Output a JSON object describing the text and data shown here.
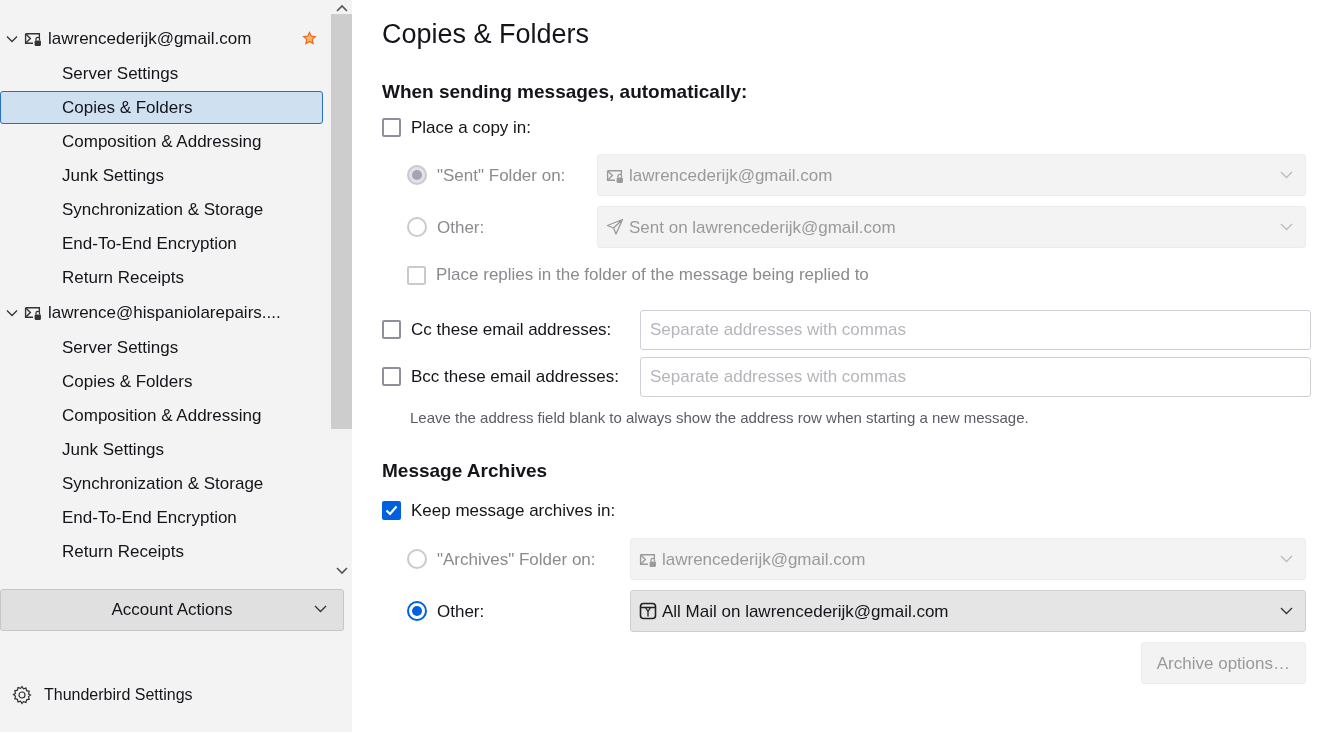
{
  "sidebar": {
    "accounts": [
      {
        "name": "lawrencederijk@gmail.com",
        "expanded": true,
        "default": true,
        "children": [
          {
            "label": "Server Settings",
            "selected": false
          },
          {
            "label": "Copies & Folders",
            "selected": true
          },
          {
            "label": "Composition & Addressing",
            "selected": false
          },
          {
            "label": "Junk Settings",
            "selected": false
          },
          {
            "label": "Synchronization & Storage",
            "selected": false
          },
          {
            "label": "End-To-End Encryption",
            "selected": false
          },
          {
            "label": "Return Receipts",
            "selected": false
          }
        ]
      },
      {
        "name": "lawrence@hispaniolarepairs....",
        "expanded": true,
        "default": false,
        "children": [
          {
            "label": "Server Settings",
            "selected": false
          },
          {
            "label": "Copies & Folders",
            "selected": false
          },
          {
            "label": "Composition & Addressing",
            "selected": false
          },
          {
            "label": "Junk Settings",
            "selected": false
          },
          {
            "label": "Synchronization & Storage",
            "selected": false
          },
          {
            "label": "End-To-End Encryption",
            "selected": false
          },
          {
            "label": "Return Receipts",
            "selected": false
          }
        ]
      }
    ],
    "account_actions": {
      "label": "Account Actions"
    },
    "footer_items": [
      {
        "label": "Thunderbird Settings"
      }
    ]
  },
  "page": {
    "title": "Copies & Folders",
    "sending": {
      "heading": "When sending messages, automatically:",
      "place_copy": {
        "label": "Place a copy in:",
        "checked": false
      },
      "destinations": [
        {
          "label": "\"Sent\" Folder on:",
          "selected": true,
          "disabled": true,
          "kind": "account",
          "value": "lawrencederijk@gmail.com"
        },
        {
          "label": "Other:",
          "selected": false,
          "disabled": true,
          "kind": "sent",
          "value": "Sent on lawrencederijk@gmail.com"
        }
      ],
      "replies": {
        "label": "Place replies in the folder of the message being replied to",
        "checked": false,
        "disabled": true
      },
      "address_rows": [
        {
          "label": "Cc these email addresses:",
          "checked": false,
          "placeholder": "Separate addresses with commas"
        },
        {
          "label": "Bcc these email addresses:",
          "checked": false,
          "placeholder": "Separate addresses with commas"
        }
      ],
      "hint": "Leave the address field blank to always show the address row when starting a new message."
    },
    "archives": {
      "heading": "Message Archives",
      "keep": {
        "label": "Keep message archives in:",
        "checked": true
      },
      "destinations": [
        {
          "label": "\"Archives\" Folder on:",
          "selected": false,
          "disabled": true,
          "kind": "account",
          "value": "lawrencederijk@gmail.com"
        },
        {
          "label": "Other:",
          "selected": true,
          "disabled": false,
          "kind": "archive",
          "value": "All Mail on lawrencederijk@gmail.com"
        }
      ],
      "options_button": {
        "label": "Archive options…",
        "disabled": true
      }
    }
  }
}
